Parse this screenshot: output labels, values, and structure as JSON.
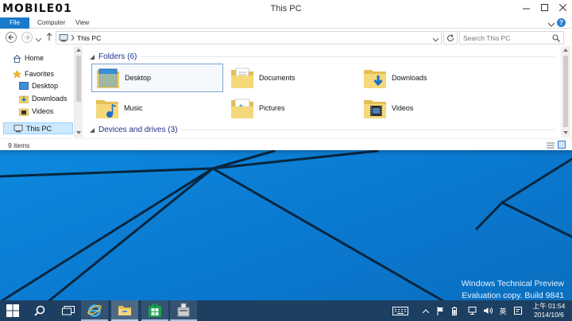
{
  "logo": {
    "text": "MOBILE01"
  },
  "window": {
    "title": "This PC"
  },
  "ribbon": {
    "tabs": [
      {
        "label": "File"
      },
      {
        "label": "Computer"
      },
      {
        "label": "View"
      }
    ]
  },
  "address": {
    "location": "This PC",
    "search_placeholder": "Search This PC"
  },
  "navpane": {
    "items": [
      {
        "label": "Home"
      },
      {
        "label": "Favorites"
      },
      {
        "label": "Desktop"
      },
      {
        "label": "Downloads"
      },
      {
        "label": "Videos"
      },
      {
        "label": "This PC"
      }
    ]
  },
  "content": {
    "folders_header": "Folders (6)",
    "folders": [
      {
        "label": "Desktop"
      },
      {
        "label": "Documents"
      },
      {
        "label": "Downloads"
      },
      {
        "label": "Music"
      },
      {
        "label": "Pictures"
      },
      {
        "label": "Videos"
      }
    ],
    "devices_header": "Devices and drives (3)"
  },
  "status": {
    "count": "9 items"
  },
  "desktop": {
    "watermark_line1": "Windows Technical Preview",
    "watermark_line2": "Evaluation copy. Build 9841"
  },
  "tray": {
    "ime": "英",
    "time": "上午 01:54",
    "date": "2014/10/6"
  },
  "colors": {
    "accent": "#1979ca",
    "taskbar": "#1d3f62",
    "wallpaper": "#0a78cf",
    "selection": "#cce8ff"
  }
}
